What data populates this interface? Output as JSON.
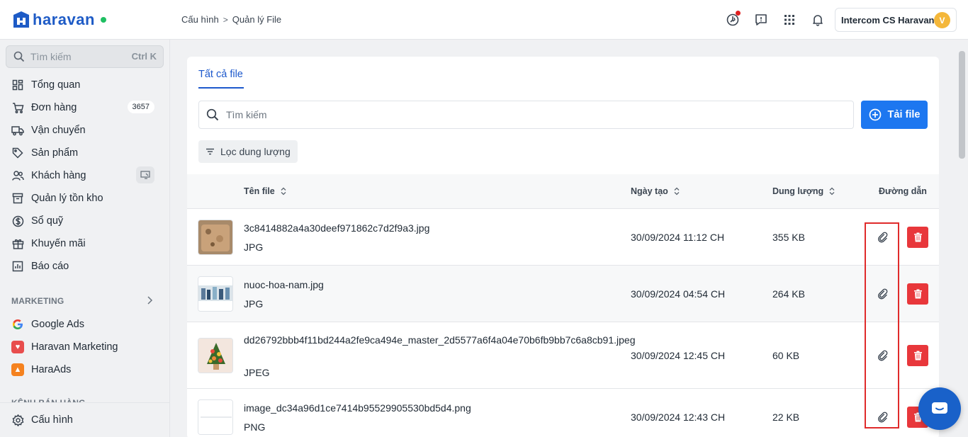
{
  "header": {
    "logo_text": "haravan",
    "breadcrumb": [
      "Cấu hình",
      "Quản lý File"
    ],
    "breadcrumb_sep": ">",
    "account_name": "Intercom CS Haravan",
    "avatar_letter": "V"
  },
  "sidebar": {
    "search_placeholder": "Tìm kiếm",
    "search_shortcut": "Ctrl K",
    "items": [
      {
        "label": "Tổng quan",
        "icon": "dashboard-icon"
      },
      {
        "label": "Đơn hàng",
        "icon": "cart-icon",
        "badge": "3657"
      },
      {
        "label": "Vận chuyển",
        "icon": "truck-icon"
      },
      {
        "label": "Sản phẩm",
        "icon": "tag-icon"
      },
      {
        "label": "Khách hàng",
        "icon": "users-icon"
      },
      {
        "label": "Quản lý tồn kho",
        "icon": "inventory-icon"
      },
      {
        "label": "Sổ quỹ",
        "icon": "dollar-icon"
      },
      {
        "label": "Khuyến mãi",
        "icon": "gift-icon"
      },
      {
        "label": "Báo cáo",
        "icon": "report-icon"
      }
    ],
    "marketing_heading": "MARKETING",
    "marketing_items": [
      {
        "label": "Google Ads",
        "icon": "google-icon"
      },
      {
        "label": "Haravan Marketing",
        "icon": "haravan-marketing-icon"
      },
      {
        "label": "HaraAds",
        "icon": "haraads-icon"
      }
    ],
    "sales_heading": "KÊNH BÁN HÀNG",
    "footer_label": "Cấu hình"
  },
  "main": {
    "tab_label": "Tất cả file",
    "search_placeholder": "Tìm kiếm",
    "upload_label": "Tải file",
    "filter_label": "Lọc dung lượng",
    "columns": {
      "name": "Tên file",
      "created": "Ngày tạo",
      "size": "Dung lượng",
      "link": "Đường dẫn"
    },
    "files": [
      {
        "name": "3c8414882a4a30deef971862c7d2f9a3.jpg",
        "type": "JPG",
        "created": "30/09/2024 11:12 CH",
        "size": "355 KB"
      },
      {
        "name": "nuoc-hoa-nam.jpg",
        "type": "JPG",
        "created": "30/09/2024 04:54 CH",
        "size": "264 KB"
      },
      {
        "name": "dd26792bbb4f11bd244a2fe9ca494e_master_2d5577a6f4a04e70b6fb9bb7c6a8cb91.jpeg",
        "type": "JPEG",
        "created": "30/09/2024 12:45 CH",
        "size": "60 KB"
      },
      {
        "name": "image_dc34a96d1ce7414b95529905530bd5d4.png",
        "type": "PNG",
        "created": "30/09/2024 12:43 CH",
        "size": "22 KB"
      }
    ]
  },
  "colors": {
    "primary": "#1d77f0",
    "danger": "#e8373b",
    "highlight_border": "#e02b2b",
    "brand": "#1e5bc6"
  }
}
